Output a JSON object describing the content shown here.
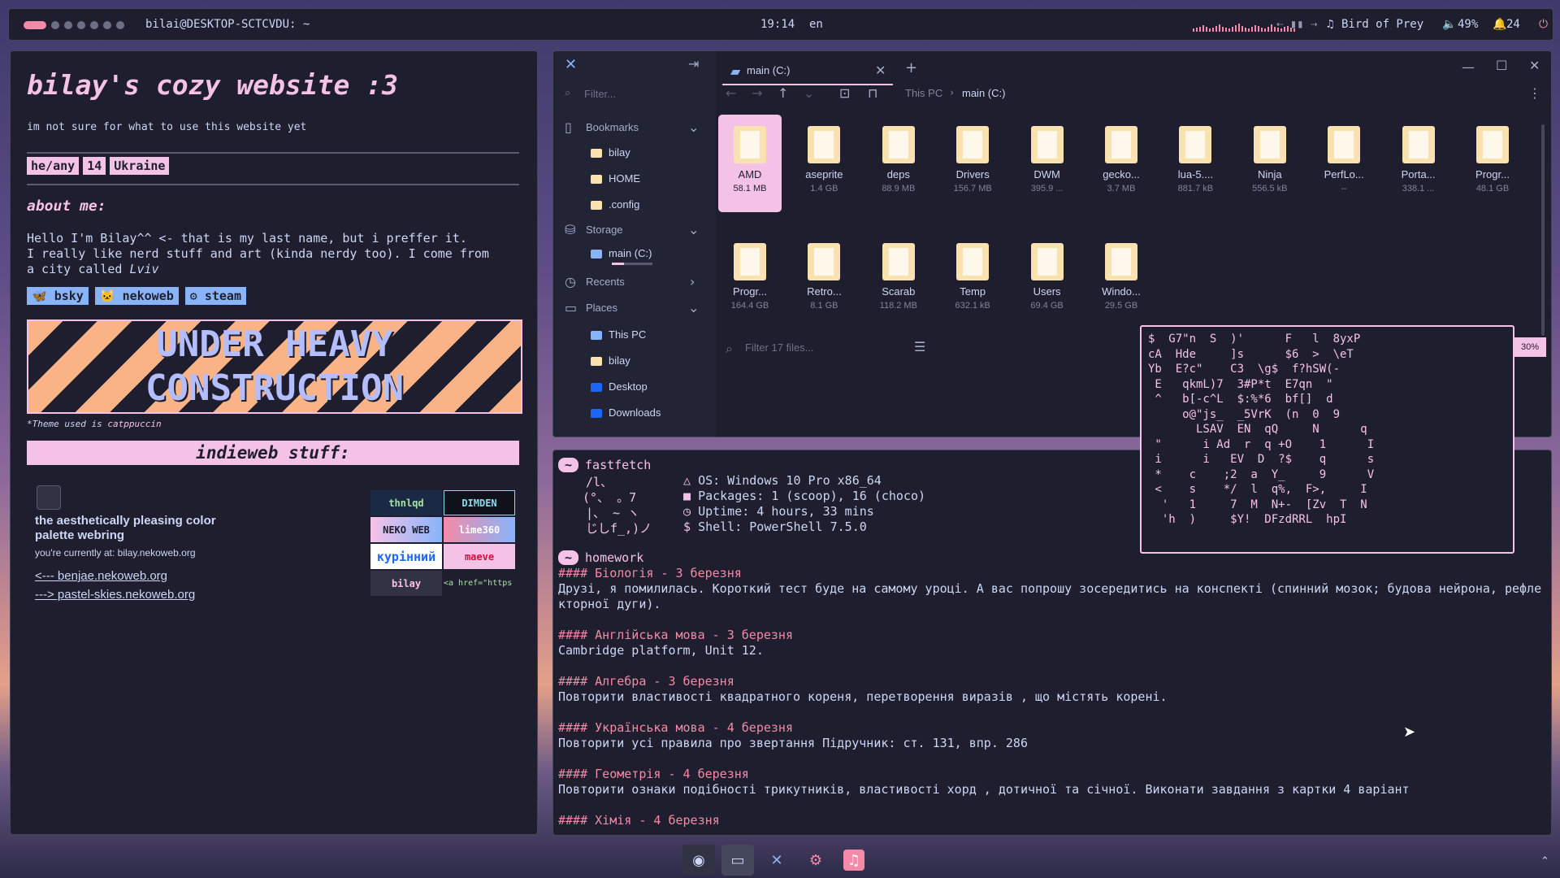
{
  "topbar": {
    "title": "bilai@DESKTOP-SCTCVDU: ~",
    "clock": "19:14",
    "lang": "en",
    "media_controls": "⇠ ▮▮ ⇢",
    "music_icon": "music-note-icon",
    "track": "Bird of Prey",
    "volume": "49%",
    "notifications": "24",
    "accent": "#f38ba8"
  },
  "web": {
    "title": "bilay's cozy website :3",
    "subtitle": "im not sure for what to use this website yet",
    "tags": [
      "he/any",
      "14",
      "Ukraine"
    ],
    "about_heading": "about me:",
    "about_line1": "Hello I'm Bilay^^ <- that is my last name, but i preffer it.",
    "about_line2": "I really like nerd stuff and art (kinda nerdy too). I come from",
    "about_line3a": "a city called ",
    "about_line3b": "Lviv",
    "links": [
      "bsky",
      "nekoweb",
      "steam"
    ],
    "banner_line1": "UNDER HEAVY",
    "banner_line2": "CONSTRUCTION",
    "theme_prefix": "*Theme used is ",
    "theme_name": "catppuccin",
    "indieweb_heading": "indieweb stuff:",
    "webring_title": "the aesthetically pleasing color palette webring",
    "webring_current": "you're currently at: bilay.nekoweb.org",
    "webring_prev": "<--- benjae.nekoweb.org",
    "webring_next": "---> pastel-skies.nekoweb.org",
    "buttons": [
      "thnlqd",
      "DIMDEN",
      "NEKO WEB",
      "lime360",
      "курінний",
      "maeve",
      "bilay",
      "<a href=\"https"
    ]
  },
  "filemanager": {
    "filter_placeholder": "Filter...",
    "tab_title": "main (C:)",
    "breadcrumb": [
      "This PC",
      "main (C:)"
    ],
    "sidebar": {
      "bookmarks_label": "Bookmarks",
      "bookmarks": [
        "bilay",
        "HOME",
        ".config"
      ],
      "storage_label": "Storage",
      "storage": [
        "main (C:)"
      ],
      "recents_label": "Recents",
      "places_label": "Places",
      "places": [
        "This PC",
        "bilay",
        "Desktop",
        "Downloads"
      ]
    },
    "files": [
      {
        "name": "AMD",
        "size": "58.1 MB"
      },
      {
        "name": "aseprite",
        "size": "1.4 GB"
      },
      {
        "name": "deps",
        "size": "88.9 MB"
      },
      {
        "name": "Drivers",
        "size": "156.7 MB"
      },
      {
        "name": "DWM",
        "size": "395.9 ..."
      },
      {
        "name": "gecko...",
        "size": "3.7 MB"
      },
      {
        "name": "lua-5....",
        "size": "881.7 kB"
      },
      {
        "name": "Ninja",
        "size": "556.5 kB"
      },
      {
        "name": "PerfLo...",
        "size": "--"
      },
      {
        "name": "Porta...",
        "size": "338.1 ..."
      },
      {
        "name": "Progr...",
        "size": "48.1 GB"
      },
      {
        "name": "Progr...",
        "size": "164.4 GB"
      },
      {
        "name": "Retro...",
        "size": "8.1 GB"
      },
      {
        "name": "Scarab",
        "size": "118.2 MB"
      },
      {
        "name": "Temp",
        "size": "632.1 kB"
      },
      {
        "name": "Users",
        "size": "69.4 GB"
      },
      {
        "name": "Windo...",
        "size": "29.5 GB"
      }
    ],
    "filter_files_placeholder": "Filter 17 files...",
    "storage_used_pct": 30,
    "storage_used_label": "30%"
  },
  "terminal": {
    "prompt_symbol": "~",
    "cmd1": "fastfetch",
    "ascii": [
      "/l、",
      "(°、 。7",
      "|、 ~ ヽ",
      "じしf_,)ノ"
    ],
    "os": "OS: Windows 10 Pro x86_64",
    "packages": "Packages: 1 (scoop), 16 (choco)",
    "uptime": "Uptime: 4 hours, 33 mins",
    "shell": "Shell: PowerShell 7.5.0",
    "cmd2": "homework",
    "hw": [
      {
        "h": "#### Біологія - 3 березня",
        "t": "Друзі, я помилилась. Короткий тест буде на самому уроці. А вас попрошу зосередитись на конспекті (спинний мозок; будова нейрона, рефле",
        "t2": "кторної дуги)."
      },
      {
        "h": "#### Англійська мова - 3 березня",
        "t": "Cambridge platform, Unit 12."
      },
      {
        "h": "#### Алгебра - 3 березня",
        "t": "Повторити властивості квадратного кореня, перетворення виразів , що містять корені."
      },
      {
        "h": "#### Українська мова - 4 березня",
        "t": "Повторити усі правила про звертання Підручник: ст. 131, впр. 286"
      },
      {
        "h": "#### Геометрія - 4 березня",
        "t": "Повторити ознаки подібності трикутників, властивості хорд , дотичної та січної. Виконати завдання з картки 4 варіант"
      },
      {
        "h": "#### Хімія - 4 березня",
        "t": ""
      }
    ]
  },
  "matrix_text": "$  G7\"n  S  )'      F   l  8yxP\ncA  Hde     ]s      $6  >  \\eT\nYb  E?c\"    C3  \\g$  f?hSW(-\n E   qkmL)7  3#P*t  E7qn  \"\n ^   b[-c^L  $:%*6  bf[]  d\n     o@\"js_  _5VrK  (n  0  9\n       LSAV  EN  qQ     N      q\n \"      i Ad  r  q +O    1      I\n i      i   EV  D  ?$    q      s\n *    c    ;2  a  Y_     9      V\n <    s    */  l  q%,  F>,     I\n  '   1     7  M  N+-  [Zv  T  N\n  'h  )     $Y!  DFzdRRL  hpI",
  "dock": {
    "items": [
      "obs-icon",
      "terminal-icon",
      "vscode-icon",
      "utility-icon",
      "music-app-icon"
    ]
  }
}
